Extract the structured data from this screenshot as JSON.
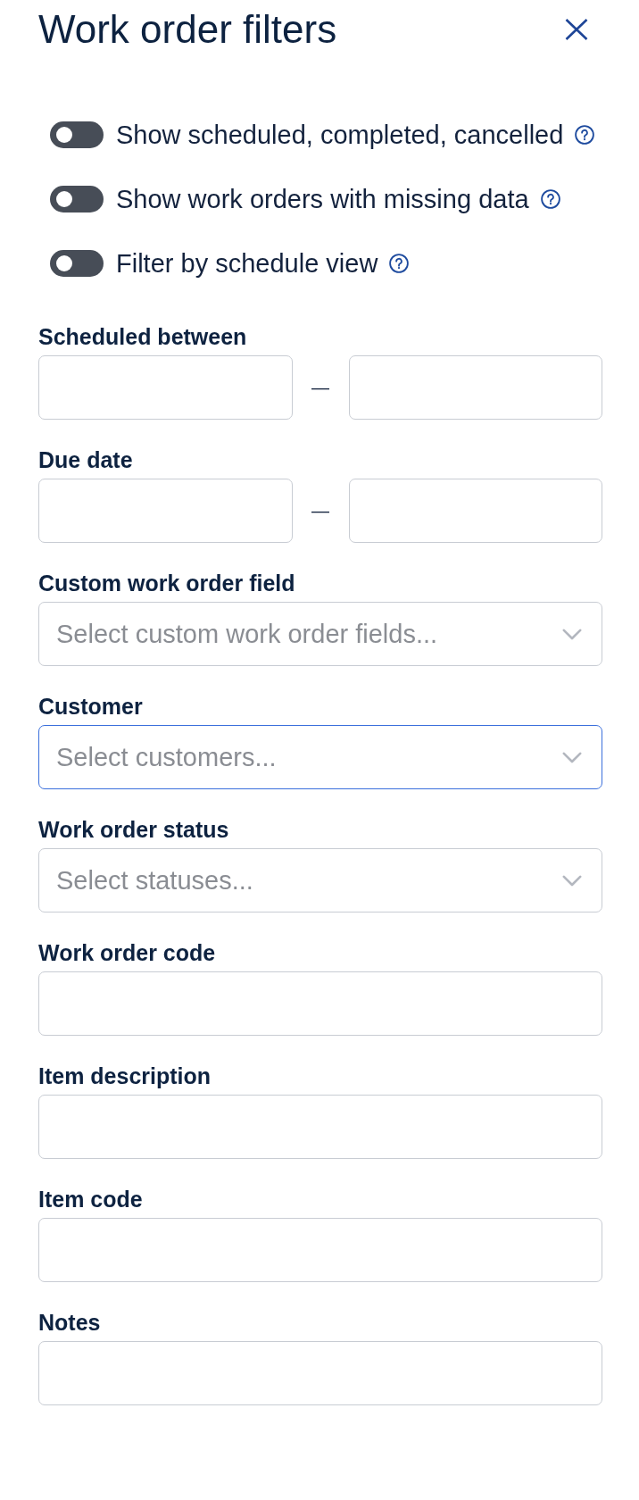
{
  "panel": {
    "title": "Work order filters"
  },
  "toggles": [
    {
      "label": "Show scheduled, completed, cancelled",
      "on": false
    },
    {
      "label": "Show work orders with missing data",
      "on": false
    },
    {
      "label": "Filter by schedule view",
      "on": false
    }
  ],
  "fields": [
    {
      "kind": "range",
      "label": "Scheduled between",
      "separator": "—"
    },
    {
      "kind": "range",
      "label": "Due date",
      "separator": "—"
    },
    {
      "kind": "select",
      "label": "Custom work order field",
      "placeholder": "Select custom work order fields...",
      "focused": false
    },
    {
      "kind": "select",
      "label": "Customer",
      "placeholder": "Select customers...",
      "focused": true
    },
    {
      "kind": "select",
      "label": "Work order status",
      "placeholder": "Select statuses...",
      "focused": false
    },
    {
      "kind": "text",
      "label": "Work order code",
      "focused": false
    },
    {
      "kind": "text",
      "label": "Item description",
      "focused": false
    },
    {
      "kind": "text",
      "label": "Item code",
      "focused": false
    },
    {
      "kind": "text",
      "label": "Notes",
      "focused": false
    }
  ]
}
